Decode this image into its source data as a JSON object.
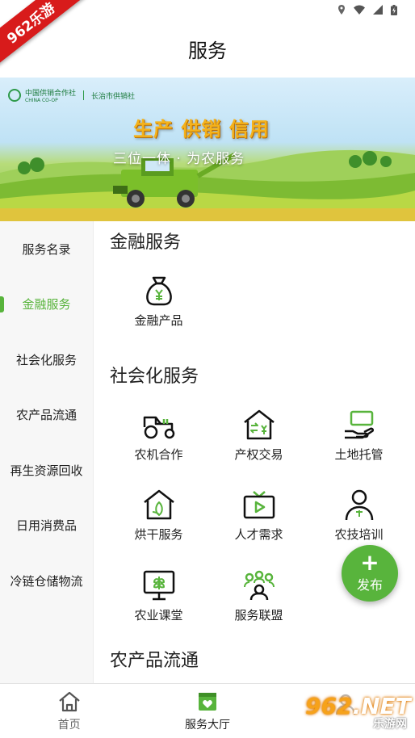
{
  "ribbon": {
    "text": "962乐游"
  },
  "header": {
    "title": "服务"
  },
  "banner": {
    "logo_text": "中国供销合作社",
    "logo_sub": "CHINA CO-OP",
    "org": "长治市供销社",
    "headline": "生产 供销 信用",
    "subline": "三位一体 · 为农服务"
  },
  "sidebar": {
    "items": [
      {
        "label": "服务名录"
      },
      {
        "label": "金融服务"
      },
      {
        "label": "社会化服务"
      },
      {
        "label": "农产品流通"
      },
      {
        "label": "再生资源回收"
      },
      {
        "label": "日用消费品"
      },
      {
        "label": "冷链仓储物流"
      }
    ],
    "active_index": 1
  },
  "sections": {
    "finance": {
      "title": "金融服务",
      "items": [
        {
          "label": "金融产品",
          "icon": "money-bag-icon"
        }
      ]
    },
    "social": {
      "title": "社会化服务",
      "items": [
        {
          "label": "农机合作",
          "icon": "tractor-icon"
        },
        {
          "label": "产权交易",
          "icon": "property-exchange-icon"
        },
        {
          "label": "土地托管",
          "icon": "land-trust-icon"
        },
        {
          "label": "烘干服务",
          "icon": "drying-house-icon"
        },
        {
          "label": "人才需求",
          "icon": "tv-play-icon"
        },
        {
          "label": "农技培训",
          "icon": "trainee-icon"
        },
        {
          "label": "农业课堂",
          "icon": "monitor-plant-icon"
        },
        {
          "label": "服务联盟",
          "icon": "group-icon"
        }
      ]
    },
    "circulation": {
      "title": "农产品流通"
    }
  },
  "fab": {
    "plus": "+",
    "label": "发布"
  },
  "tabbar": {
    "items": [
      {
        "label": "首页",
        "icon": "home-icon"
      },
      {
        "label": "服务大厅",
        "icon": "service-hall-icon"
      }
    ]
  },
  "watermark": {
    "big": "962",
    "suffix": ".NET",
    "small": "乐游网"
  },
  "colors": {
    "accent": "#58b43c",
    "text": "#222222",
    "sidebar_bg": "#f7f7f7"
  }
}
